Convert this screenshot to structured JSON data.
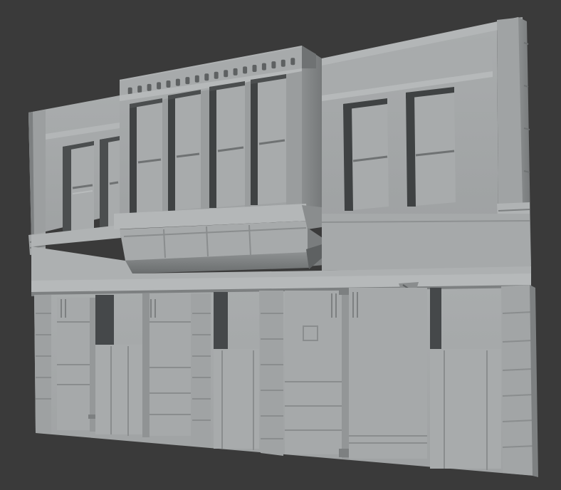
{
  "viewport": {
    "background_color": "#3a3a3a",
    "content": "3d-building-facade-model-render"
  },
  "model": {
    "base_color": "#a4a7a8",
    "shadow_color": "#5e6162",
    "highlight_color": "#b8bbbc",
    "dark_recess_color": "#3f4243"
  }
}
